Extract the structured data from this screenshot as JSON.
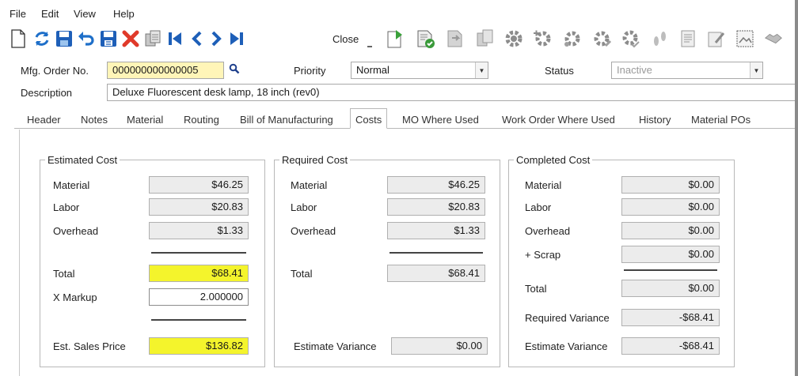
{
  "menu": [
    "File",
    "Edit",
    "View",
    "Help"
  ],
  "toolbar": {
    "close_label": "Close",
    "icons": [
      "new-doc-icon",
      "refresh-icon",
      "save-icon",
      "undo-icon",
      "save-as-icon",
      "delete-icon",
      "copy-icon",
      "first-record-icon",
      "prev-record-icon",
      "next-record-icon",
      "last-record-icon",
      "close-dropdown-icon",
      "export-icon",
      "approve-icon",
      "forward-doc-icon",
      "doc-copy-icon",
      "gear-icon",
      "gear-add-icon",
      "gear-link-icon",
      "gear-edit-icon",
      "gear-check-icon",
      "footprints-icon",
      "notes-icon",
      "pencil-icon",
      "image-icon",
      "handshake-icon"
    ]
  },
  "header": {
    "mfg_order_label": "Mfg. Order No.",
    "mfg_order_value": "000000000000005",
    "priority_label": "Priority",
    "priority_value": "Normal",
    "status_label": "Status",
    "status_value": "Inactive",
    "description_label": "Description",
    "description_value": "Deluxe Fluorescent desk lamp, 18 inch (rev0)"
  },
  "tabs": [
    "Header",
    "Notes",
    "Material",
    "Routing",
    "Bill of Manufacturing",
    "Costs",
    "MO Where Used",
    "Work Order Where Used",
    "History",
    "Material POs"
  ],
  "active_tab": "Costs",
  "estimated": {
    "title": "Estimated Cost",
    "material_label": "Material",
    "material": "$46.25",
    "labor_label": "Labor",
    "labor": "$20.83",
    "overhead_label": "Overhead",
    "overhead": "$1.33",
    "total_label": "Total",
    "total": "$68.41",
    "markup_label": "X Markup",
    "markup": "2.000000",
    "sales_label": "Est. Sales Price",
    "sales": "$136.82"
  },
  "required": {
    "title": "Required Cost",
    "material_label": "Material",
    "material": "$46.25",
    "labor_label": "Labor",
    "labor": "$20.83",
    "overhead_label": "Overhead",
    "overhead": "$1.33",
    "total_label": "Total",
    "total": "$68.41",
    "variance_label": "Estimate Variance",
    "variance": "$0.00"
  },
  "completed": {
    "title": "Completed Cost",
    "material_label": "Material",
    "material": "$0.00",
    "labor_label": "Labor",
    "labor": "$0.00",
    "overhead_label": "Overhead",
    "overhead": "$0.00",
    "scrap_label": "+ Scrap",
    "scrap": "$0.00",
    "total_label": "Total",
    "total": "$0.00",
    "req_variance_label": "Required Variance",
    "req_variance": "-$68.41",
    "est_variance_label": "Estimate Variance",
    "est_variance": "-$68.41"
  },
  "colors": {
    "highlight": "#f4f42c",
    "order_field": "#fff5b8",
    "toolbar_blue": "#1e6fc9",
    "delete_red": "#e03a2a",
    "gear_gray": "#8c8c8c"
  }
}
